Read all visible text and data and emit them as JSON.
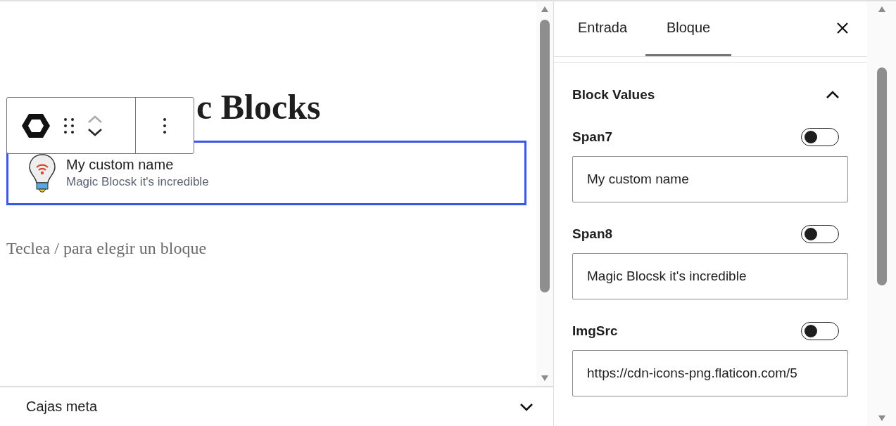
{
  "editor": {
    "title_visible": "c Blocks",
    "block": {
      "name": "My custom name",
      "subtitle": "Magic Blocsk it's incredible",
      "selected": true
    },
    "placeholder": "Teclea / para elegir un bloque"
  },
  "meta_boxes": {
    "label": "Cajas meta",
    "expanded": false
  },
  "sidebar": {
    "tabs": [
      {
        "label": "Entrada",
        "selected": false
      },
      {
        "label": "Bloque",
        "selected": true
      }
    ],
    "panel": {
      "title": "Block Values",
      "expanded": true,
      "fields": [
        {
          "label": "Span7",
          "on": false,
          "value": "My custom name"
        },
        {
          "label": "Span8",
          "on": false,
          "value": "Magic Blocsk it's incredible"
        },
        {
          "label": "ImgSrc",
          "on": false,
          "value": "https://cdn-icons-png.flaticon.com/5"
        }
      ]
    }
  }
}
